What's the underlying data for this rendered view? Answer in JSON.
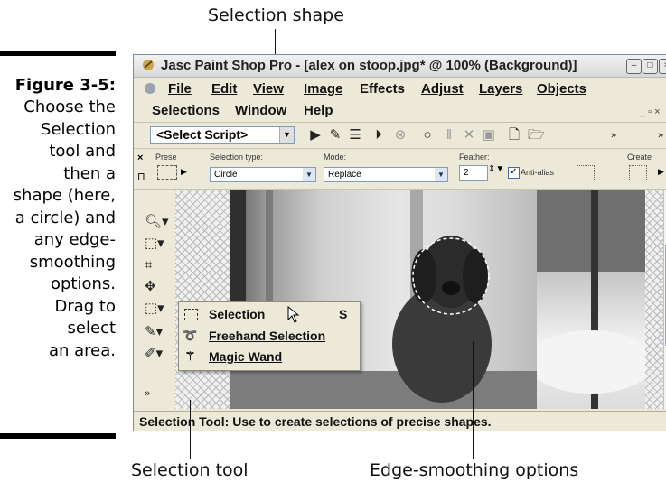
{
  "callouts": {
    "top": "Selection shape",
    "bottom_left": "Selection tool",
    "bottom_right": "Edge-smoothing options"
  },
  "figure": {
    "title": "Figure 3-5:",
    "lines": [
      "Choose the",
      "Selection",
      "tool and",
      "then a",
      "shape (here,",
      "a circle) and",
      "any edge-",
      "smoothing",
      "options.",
      "Drag to",
      "select",
      "an area."
    ]
  },
  "window": {
    "title": "Jasc Paint Shop Pro - [alex on stoop.jpg* @ 100% (Background)]",
    "menu_row1": [
      "File",
      "Edit",
      "View",
      "Image",
      "Effects",
      "Adjust",
      "Layers",
      "Objects"
    ],
    "menu_row2": [
      "Selections",
      "Window",
      "Help"
    ],
    "script_select": "<Select Script>",
    "options": {
      "presets_label": "Prese",
      "selection_type_label": "Selection type:",
      "selection_type_value": "Circle",
      "mode_label": "Mode:",
      "mode_value": "Replace",
      "feather_label": "Feather:",
      "feather_value": "2",
      "antialias_label": "Anti-alias",
      "antialias_checked": true,
      "create_label": "Create"
    },
    "flyout": [
      {
        "label": "Selection",
        "shortcut": "S",
        "icon": "selection-rect-icon"
      },
      {
        "label": "Freehand Selection",
        "shortcut": "",
        "icon": "freehand-lasso-icon"
      },
      {
        "label": "Magic Wand",
        "shortcut": "",
        "icon": "magic-wand-icon"
      }
    ],
    "status": "Selection Tool: Use to create selections of precise shapes."
  },
  "colors": {
    "window_bg": "#ece9d8",
    "accent": "#7f9db9"
  }
}
